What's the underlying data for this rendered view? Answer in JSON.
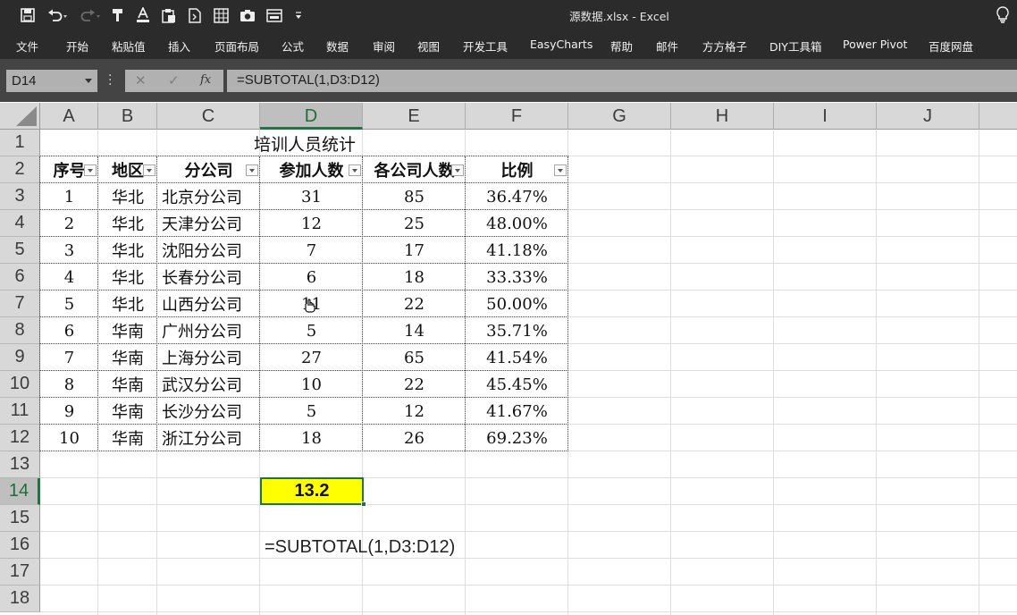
{
  "window": {
    "title": "源数据.xlsx  -  Excel"
  },
  "quick_access": {
    "icons": [
      "save-icon",
      "undo-icon",
      "redo-icon",
      "format-painter-icon",
      "font-color-icon",
      "paste-icon",
      "page-icon",
      "table-icon",
      "camera-icon",
      "form-icon",
      "customize-icon"
    ]
  },
  "ribbon": {
    "tabs": [
      "文件",
      "开始",
      "粘贴值",
      "插入",
      "页面布局",
      "公式",
      "数据",
      "审阅",
      "视图",
      "开发工具",
      "EasyCharts",
      "帮助",
      "邮件",
      "方方格子",
      "DIY工具箱",
      "Power Pivot",
      "百度网盘"
    ]
  },
  "formula_bar": {
    "name_box": "D14",
    "cancel_glyph": "✕",
    "enter_glyph": "✓",
    "fx_glyph": "fx",
    "formula": "=SUBTOTAL(1,D3:D12)"
  },
  "grid": {
    "columns": [
      "A",
      "B",
      "C",
      "D",
      "E",
      "F",
      "G",
      "H",
      "I",
      "J"
    ],
    "rows": [
      "1",
      "2",
      "3",
      "4",
      "5",
      "6",
      "7",
      "8",
      "9",
      "10",
      "11",
      "12",
      "13",
      "14",
      "15",
      "16",
      "17",
      "18"
    ],
    "selected_column": "D",
    "selected_row": "14"
  },
  "sheet": {
    "title": "培训人员统计",
    "headers": [
      "序号",
      "地区",
      "分公司",
      "参加人数",
      "各公司人数",
      "比例"
    ],
    "rows": [
      [
        "1",
        "华北",
        "北京分公司",
        "31",
        "85",
        "36.47%"
      ],
      [
        "2",
        "华北",
        "天津分公司",
        "12",
        "25",
        "48.00%"
      ],
      [
        "3",
        "华北",
        "沈阳分公司",
        "7",
        "17",
        "41.18%"
      ],
      [
        "4",
        "华北",
        "长春分公司",
        "6",
        "18",
        "33.33%"
      ],
      [
        "5",
        "华北",
        "山西分公司",
        "11",
        "22",
        "50.00%"
      ],
      [
        "6",
        "华南",
        "广州分公司",
        "5",
        "14",
        "35.71%"
      ],
      [
        "7",
        "华南",
        "上海分公司",
        "27",
        "65",
        "41.54%"
      ],
      [
        "8",
        "华南",
        "武汉分公司",
        "10",
        "22",
        "45.45%"
      ],
      [
        "9",
        "华南",
        "长沙分公司",
        "5",
        "12",
        "41.67%"
      ],
      [
        "10",
        "华南",
        "浙江分公司",
        "18",
        "26",
        "69.23%"
      ]
    ],
    "result_value": "13.2",
    "formula_note": "=SUBTOTAL(1,D3:D12)"
  },
  "colors": {
    "title_bar": "#2b2b2b",
    "accent": "#217346",
    "highlight": "#ffff00"
  }
}
